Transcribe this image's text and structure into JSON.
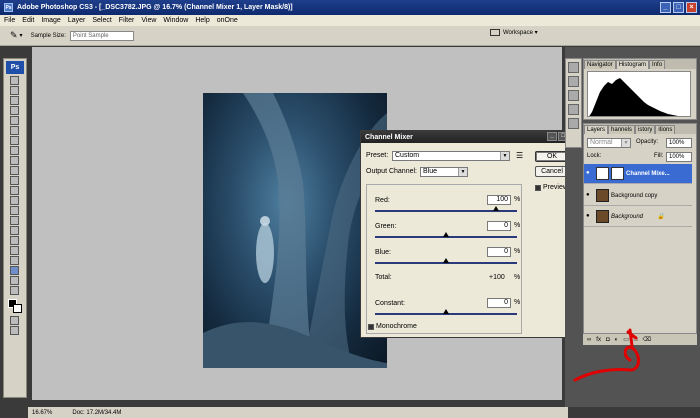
{
  "window": {
    "title": "Adobe Photoshop CS3 - [_DSC3782.JPG @ 16.7% (Channel Mixer 1, Layer Mask/8)]"
  },
  "menu": [
    "File",
    "Edit",
    "Image",
    "Layer",
    "Select",
    "Filter",
    "View",
    "Window",
    "Help",
    "onOne"
  ],
  "options": {
    "sample_label": "Sample Size:",
    "sample_value": "Point Sample",
    "workspace_label": "Workspace ▾"
  },
  "toolbox": {
    "badge": "Ps"
  },
  "status": {
    "zoom": "16.67%",
    "doc": "Doc: 17.2M/34.4M"
  },
  "dialog": {
    "title": "Channel Mixer",
    "preset_label": "Preset:",
    "preset_value": "Custom",
    "output_label": "Output Channel:",
    "output_value": "Blue",
    "ok": "OK",
    "cancel": "Cancel",
    "preview_label": "Preview",
    "channels": [
      {
        "label": "Red:",
        "value": "100",
        "slider": 0.85
      },
      {
        "label": "Green:",
        "value": "0",
        "slider": 0.5
      },
      {
        "label": "Blue:",
        "value": "0",
        "slider": 0.5
      }
    ],
    "total_label": "Total:",
    "total_value": "+100",
    "pct": "%",
    "constant_label": "Constant:",
    "constant_value": "0",
    "constant_slider": 0.5,
    "monochrome_label": "Monochrome"
  },
  "nav_panel": {
    "tabs": [
      "Navigator",
      "Histogram",
      "Info"
    ]
  },
  "layers_panel": {
    "tabs": [
      "Layers",
      "hannels",
      "istory",
      "itions"
    ],
    "blend": "Normal",
    "opacity_label": "Opacity:",
    "opacity_value": "100%",
    "lock_label": "Lock:",
    "fill_label": "Fill:",
    "fill_value": "100%",
    "layers": [
      {
        "name": "Channel Mixe...",
        "selected": true
      },
      {
        "name": "Background copy",
        "selected": false
      },
      {
        "name": "Background",
        "selected": false
      }
    ],
    "bottom_icons": [
      "link-icon",
      "fx-icon",
      "mask-icon",
      "adjustment-icon",
      "folder-icon",
      "new-layer-icon",
      "trash-icon"
    ]
  }
}
